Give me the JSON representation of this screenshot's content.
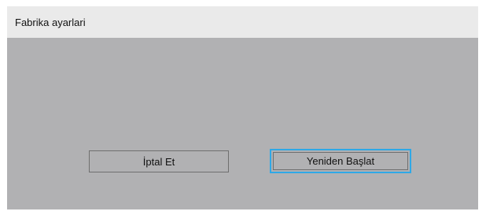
{
  "dialog": {
    "title": "Fabrika ayarlari",
    "cancel_label": "İptal Et",
    "restart_label": "Yeniden Başlat",
    "focused_button": "restart",
    "colors": {
      "background": "#b1b1b3",
      "title_bar": "#eaeaea",
      "focus_border": "#2fa8e6"
    }
  }
}
